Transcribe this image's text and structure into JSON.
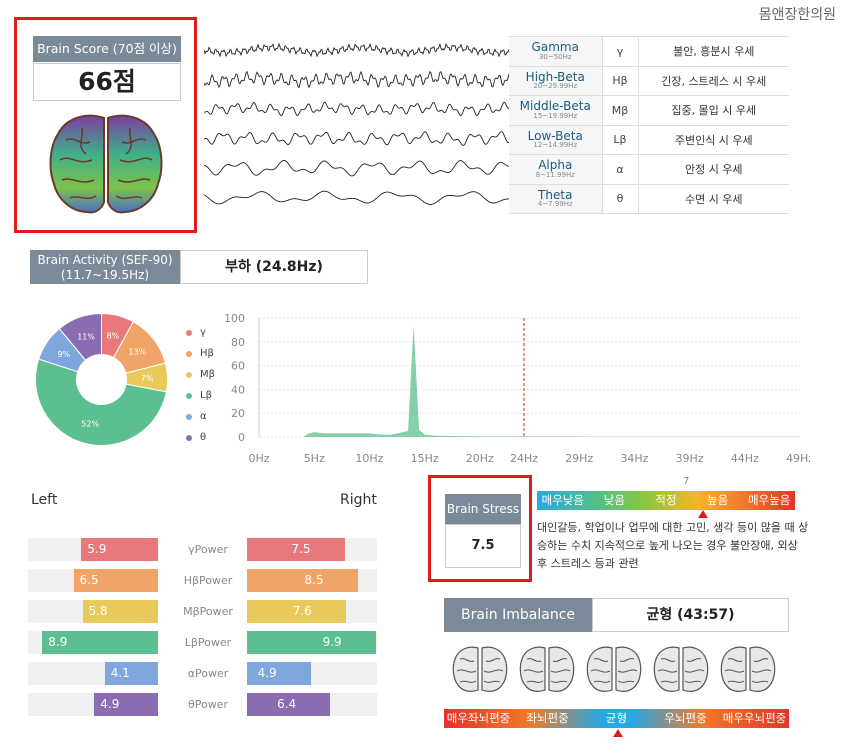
{
  "brand": "몸앤장한의원",
  "brain_score": {
    "title": "Brain Score (70점 이상)",
    "value": "66점"
  },
  "waves": [
    {
      "name": "Gamma",
      "range": "30~50Hz",
      "symbol": "γ",
      "desc": "불안, 흥분시 우세"
    },
    {
      "name": "High-Beta",
      "range": "20~29.99Hz",
      "symbol": "Hβ",
      "desc": "긴장, 스트레스 시 우세"
    },
    {
      "name": "Middle-Beta",
      "range": "15~19.99Hz",
      "symbol": "Mβ",
      "desc": "집중, 몰입 시 우세"
    },
    {
      "name": "Low-Beta",
      "range": "12~14.99Hz",
      "symbol": "Lβ",
      "desc": "주변인식 시 우세"
    },
    {
      "name": "Alpha",
      "range": "8~11.99Hz",
      "symbol": "α",
      "desc": "안정 시 우세"
    },
    {
      "name": "Theta",
      "range": "4~7.99Hz",
      "symbol": "θ",
      "desc": "수면 시 우세"
    }
  ],
  "activity": {
    "title_line1": "Brain Activity (SEF-90)",
    "title_line2": "(11.7~19.5Hz)",
    "value": "부하 (24.8Hz)"
  },
  "legend": [
    {
      "label": "γ",
      "color": "#e8787a"
    },
    {
      "label": "Hβ",
      "color": "#f0a467"
    },
    {
      "label": "Mβ",
      "color": "#e8c95a"
    },
    {
      "label": "Lβ",
      "color": "#5cbf8f"
    },
    {
      "label": "α",
      "color": "#7fa7dd"
    },
    {
      "label": "θ",
      "color": "#8a6db1"
    }
  ],
  "chart_data": [
    {
      "type": "pie",
      "values": [
        8,
        13,
        7,
        52,
        9,
        11
      ],
      "labels": [
        "8%",
        "13%",
        "7%",
        "52%",
        "9%",
        "11%"
      ],
      "categories": [
        "γ",
        "Hβ",
        "Mβ",
        "Lβ",
        "α",
        "θ"
      ]
    },
    {
      "type": "area",
      "x_ticks": [
        "0Hz",
        "5Hz",
        "10Hz",
        "15Hz",
        "20Hz",
        "24Hz",
        "29Hz",
        "34Hz",
        "39Hz",
        "44Hz",
        "49Hz"
      ],
      "y_ticks": [
        "0",
        "20",
        "40",
        "60",
        "80",
        "100"
      ],
      "ylim": [
        0,
        100
      ],
      "xlim": [
        0,
        49
      ],
      "marker_x": 24,
      "series_x": [
        0,
        4,
        4.5,
        5,
        6,
        8,
        10,
        11,
        12,
        13.5,
        14,
        14.5,
        15,
        16,
        20,
        25,
        30,
        35,
        40,
        45,
        49
      ],
      "series_y": [
        0,
        0,
        3,
        4,
        3,
        3,
        3,
        2,
        2,
        5,
        94,
        6,
        2,
        1,
        0.5,
        0.5,
        0.3,
        0.3,
        0.3,
        0.3,
        0.3
      ]
    },
    {
      "type": "bar",
      "categories": [
        "γPower",
        "HβPower",
        "MβPower",
        "LβPower",
        "αPower",
        "θPower"
      ],
      "left_label": "Left",
      "right_label": "Right",
      "max": 10,
      "left": [
        5.9,
        6.5,
        5.8,
        8.9,
        4.1,
        4.9
      ],
      "right": [
        7.5,
        8.5,
        7.6,
        9.9,
        4.9,
        6.4
      ],
      "left_text": [
        "5.9",
        "6.5",
        "5.8",
        "8.9",
        "4.1",
        "4.9"
      ],
      "right_text": [
        "7.5",
        "8.5",
        "7.6",
        "9.9",
        "4.9",
        "6.4"
      ]
    }
  ],
  "stress": {
    "title": "Brain Stress",
    "value": "7.5",
    "levels": [
      "매우낮음",
      "낮음",
      "적정",
      "높음",
      "매우높음"
    ],
    "marker": "7",
    "desc": "대인갈등, 학업이나 업무에 대한 고민, 생각 등이 많을 때 상승하는 수치 지속적으로 높게 나오는 경우 불안장애, 외상 후 스트레스 등과 관련"
  },
  "imbalance": {
    "title": "Brain Imbalance",
    "value": "균형 (43:57)",
    "levels": [
      "매우좌뇌편중",
      "좌뇌편중",
      "균형",
      "우뇌편중",
      "매우우뇌편중"
    ]
  }
}
